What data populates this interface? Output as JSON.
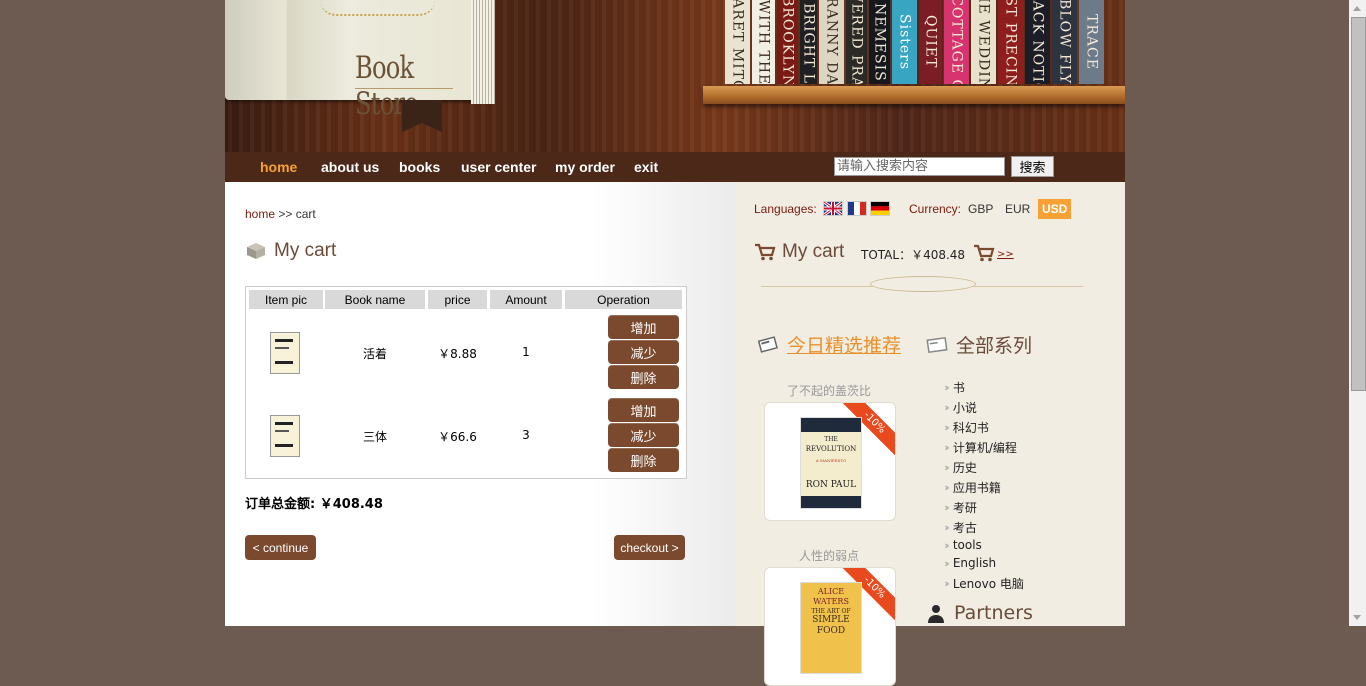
{
  "header": {
    "book_title": "Book Store",
    "shelf_spines": [
      {
        "text": "MARGARET MITCHELL",
        "color": "#e9e4d0",
        "text_color": "#3a2a1e"
      },
      {
        "text": "GONE WITH THE WIND",
        "color": "#f1efe4",
        "text_color": "#3a2a1e"
      },
      {
        "text": "BROOKLYN",
        "color": "#7a1a14",
        "text_color": "#f2e8d4"
      },
      {
        "text": "THIS BRIGHT LIGHT",
        "color": "#1f1f24",
        "text_color": "#f2e8d4"
      },
      {
        "text": "GRANNY DAN",
        "color": "#dcd6c2",
        "text_color": "#3a2a1e"
      },
      {
        "text": "ANSWERED PRAYERS",
        "color": "#2b2a26",
        "text_color": "#f2e8d4"
      },
      {
        "text": "NEMESIS",
        "color": "#17181c",
        "text_color": "#f2e8d4"
      },
      {
        "text": "Sisters",
        "color": "#38a6c3",
        "text_color": "#ffffff"
      },
      {
        "text": "QUIET",
        "color": "#7b1d24",
        "text_color": "#f2e8d4"
      },
      {
        "text": "THE COTTAGE GAME",
        "color": "#d7336e",
        "text_color": "#f2e8d4"
      },
      {
        "text": "THE WEDDING",
        "color": "#e8e2cc",
        "text_color": "#3a2a1e"
      },
      {
        "text": "LAST PRECINCT",
        "color": "#8e1d1d",
        "text_color": "#f2e8d4"
      },
      {
        "text": "BLACK NOTICE",
        "color": "#1d1d28",
        "text_color": "#f2e8d4"
      },
      {
        "text": "BLOW FLY",
        "color": "#2d3440",
        "text_color": "#f2e8d4"
      },
      {
        "text": "TRACE",
        "color": "#6d7a8a",
        "text_color": "#f2e8d4"
      }
    ]
  },
  "nav": {
    "items": [
      {
        "label": "home",
        "active": true
      },
      {
        "label": "about us",
        "active": false
      },
      {
        "label": "books",
        "active": false
      },
      {
        "label": "user center",
        "active": false
      },
      {
        "label": "my order",
        "active": false
      },
      {
        "label": "exit",
        "active": false
      }
    ],
    "search_placeholder": "请输入搜索内容",
    "search_button": "搜索"
  },
  "main": {
    "breadcrumb": {
      "home": "home",
      "sep": ">>",
      "current": "cart"
    },
    "title": "My cart",
    "table": {
      "headers": [
        "Item pic",
        "Book name",
        "price",
        "Amount",
        "Operation"
      ],
      "rows": [
        {
          "name": "活着",
          "price": "￥8.88",
          "amount": "1"
        },
        {
          "name": "三体",
          "price": "￥66.6",
          "amount": "3"
        }
      ],
      "ops": [
        "增加",
        "减少",
        "删除"
      ]
    },
    "total_text": "订单总金额: ￥408.48",
    "continue_label": "< continue",
    "checkout_label": "checkout >"
  },
  "sidebar": {
    "languages_label": "Languages:",
    "currency_label": "Currency:",
    "currencies": [
      {
        "code": "GBP",
        "active": false
      },
      {
        "code": "EUR",
        "active": false
      },
      {
        "code": "USD",
        "active": true
      }
    ],
    "cart_title": "My cart",
    "cart_total": "TOTAL：￥408.48",
    "cart_link": ">>",
    "picks_title": "今日精选推荐",
    "series_title": "全部系列",
    "picks": [
      {
        "title": "了不起的盖茨比",
        "discount": "-10%",
        "cover_lines": [
          "THE",
          "REVOLUTION",
          "A MANIFESTO",
          "RON PAUL"
        ]
      },
      {
        "title": "人性的弱点",
        "discount": "-10%",
        "cover_lines": [
          "ALICE",
          "WATERS",
          "THE ART OF",
          "SIMPLE",
          "FOOD"
        ]
      }
    ],
    "categories": [
      "书",
      "小说",
      "科幻书",
      "计算机/编程",
      "历史",
      "应用书籍",
      "考研",
      "考古",
      "tools",
      "English",
      "Lenovo 电脑"
    ],
    "partners_title": "Partners"
  },
  "colors": {
    "accent": "#f7a134",
    "brown": "#7b4a2e",
    "nav_bg": "#4c2818",
    "sidebar_bg": "#f1ede2",
    "link": "#7a1b0e"
  }
}
